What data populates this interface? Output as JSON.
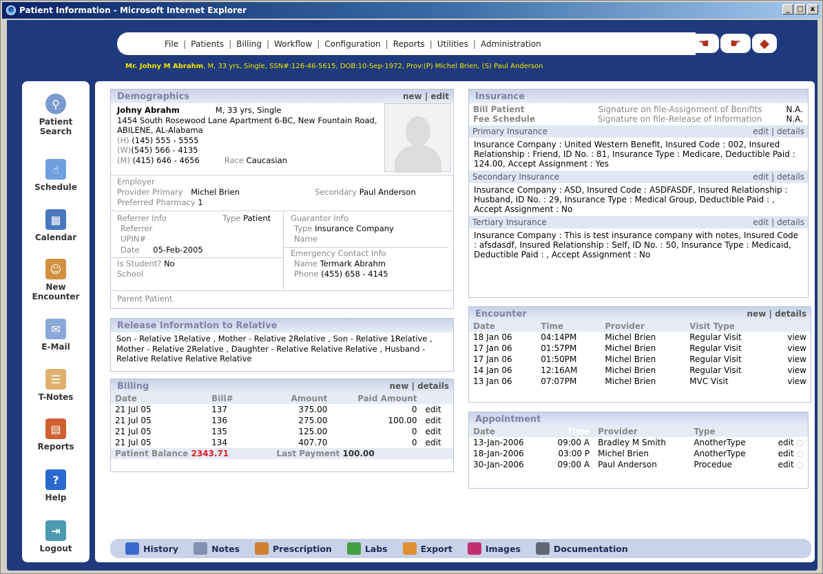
{
  "window": {
    "title": "Patient Information - Microsoft Internet Explorer",
    "min": "_",
    "max": "□",
    "close": "x"
  },
  "menu": [
    "File",
    "Patients",
    "Billing",
    "Workflow",
    "Configuration",
    "Reports",
    "Utilities",
    "Administration"
  ],
  "header_icons": [
    "hand-back-icon",
    "hand-point-icon",
    "book-icon"
  ],
  "patient_bar": {
    "name": "Mr. Johny M Abrahm",
    "details": ", M, 33 yrs, Single, SSN#:126-46-5615, DOB:10-Sep-1972, Prov:(P) Michel Brien, (S) Paul Anderson"
  },
  "nav": [
    {
      "label1": "Patient",
      "label2": "Search",
      "icon": "patient-search-icon"
    },
    {
      "label1": "Schedule",
      "label2": "",
      "icon": "schedule-icon"
    },
    {
      "label1": "Calendar",
      "label2": "",
      "icon": "calendar-icon"
    },
    {
      "label1": "New",
      "label2": "Encounter",
      "icon": "new-encounter-icon"
    },
    {
      "label1": "E-Mail",
      "label2": "",
      "icon": "email-icon"
    },
    {
      "label1": "T-Notes",
      "label2": "",
      "icon": "t-notes-icon"
    },
    {
      "label1": "Reports",
      "label2": "",
      "icon": "reports-icon"
    },
    {
      "label1": "Help",
      "label2": "",
      "icon": "help-icon"
    },
    {
      "label1": "Logout",
      "label2": "",
      "icon": "logout-icon"
    }
  ],
  "demo": {
    "title": "Demographics",
    "new": "new",
    "sep": "|",
    "edit": "edit",
    "name": "Johny Abrahm",
    "summary": "M, 33 yrs, Single",
    "address": "1454 South Rosewood Lane Apartment 6-BC, New Fountain Road, ABILENE, AL-Alabama",
    "h_lbl": "(H)",
    "h": "(145) 555 - 5555",
    "w_lbl": "(W)",
    "w": "(545) 566 - 4135",
    "m_lbl": "(M)",
    "m": "(415) 646 - 4656",
    "race_lbl": "Race",
    "race": "Caucasian",
    "employer_lbl": "Employer",
    "prov_prim_lbl": "Provider Primary",
    "prov_prim": "Michel Brien",
    "secondary_lbl": "Secondary",
    "secondary": "Paul Anderson",
    "pharm_lbl": "Preferred Pharmacy",
    "pharm": "1",
    "ref_info_lbl": "Referrer Info",
    "type_lbl": "Type",
    "ref_type": "Patient",
    "referrer_lbl": "Referrer",
    "upin_lbl": "UPIN#",
    "date_lbl": "Date",
    "ref_date": "05-Feb-2005",
    "student_lbl": "Is Student?",
    "student": "No",
    "school_lbl": "School",
    "guar_lbl": "Guarantor Info",
    "guar_type": "Insurance Company",
    "name_lbl": "Name",
    "emerg_lbl": "Emergency Contact Info",
    "emerg_name": "Termark Abrahm",
    "phone_lbl": "Phone",
    "emerg_phone": "(455) 658 - 4145",
    "parent_lbl": "Parent Patient"
  },
  "release": {
    "title": "Release Information to Relative",
    "text": "Son - Relative 1Relative , Mother - Relative 2Relative , Son - Relative 1Relative , Mother - Relative 2Relative , Daughter - Relative Relative Relative , Husband - Relative Relative Relative Relative"
  },
  "billing": {
    "title": "Billing",
    "new": "new",
    "sep": "|",
    "details": "details",
    "cols": [
      "Date",
      "Bill#",
      "Amount",
      "Paid Amount"
    ],
    "rows": [
      {
        "date": "21 Jul 05",
        "bill": "137",
        "amount": "375.00",
        "paid": "0",
        "act": "edit"
      },
      {
        "date": "21 Jul 05",
        "bill": "136",
        "amount": "275.00",
        "paid": "100.00",
        "act": "edit"
      },
      {
        "date": "21 Jul 05",
        "bill": "135",
        "amount": "125.00",
        "paid": "0",
        "act": "edit"
      },
      {
        "date": "21 Jul 05",
        "bill": "134",
        "amount": "407.70",
        "paid": "0",
        "act": "edit"
      }
    ],
    "balance_lbl": "Patient Balance",
    "balance": "2343.71",
    "last_lbl": "Last Payment",
    "last": "100.00"
  },
  "insurance": {
    "title": "Insurance",
    "bill_lbl": "Bill Patient",
    "fee_lbl": "Fee Schedule",
    "sig1": "Signature on file-Assignment of Benifits",
    "sig1_val": "N.A.",
    "sig2": "Signature on file-Release of Information",
    "sig2_val": "N.A.",
    "edit": "edit",
    "sep": "|",
    "details": "details",
    "primary_lbl": "Primary Insurance",
    "primary": "Insurance Company : United Western Benefit, Insured Code : 002, Insured Relationship : Friend, ID No. : 81, Insurance Type : Medicare, Deductible Paid : 124.00, Accept Assignment : Yes",
    "secondary_lbl": "Secondary Insurance",
    "secondary": "Insurance Company : ASD, Insured Code : ASDFASDF, Insured Relationship : Husband, ID No. : 29, Insurance Type : Medical Group, Deductible Paid : , Accept Assignment : No",
    "tertiary_lbl": "Tertiary Insurance",
    "tertiary": "Insurance Company : This is test insurance company with notes, Insured Code : afsdasdf, Insured Relationship : Self, ID No. : 50, Insurance Type : Medicaid, Deductible Paid : , Accept Assignment : No"
  },
  "encounter": {
    "title": "Encounter",
    "new": "new",
    "sep": "|",
    "details": "details",
    "cols": [
      "Date",
      "Time",
      "Provider",
      "Visit Type"
    ],
    "rows": [
      {
        "date": "18 Jan 06",
        "time": "04:14PM",
        "prov": "Michel Brien",
        "type": "Regular Visit",
        "act": "view"
      },
      {
        "date": "17 Jan 06",
        "time": "01:57PM",
        "prov": "Michel Brien",
        "type": "Regular Visit",
        "act": "view"
      },
      {
        "date": "17 Jan 06",
        "time": "01:50PM",
        "prov": "Michel Brien",
        "type": "Regular Visit",
        "act": "view"
      },
      {
        "date": "14 Jan 06",
        "time": "12:16AM",
        "prov": "Michel Brien",
        "type": "Regular Visit",
        "act": "view"
      },
      {
        "date": "13 Jan 06",
        "time": "07:07PM",
        "prov": "Michel Brien",
        "type": "MVC Visit",
        "act": "view"
      }
    ]
  },
  "appointment": {
    "title": "Appointment",
    "cols": [
      "Date",
      "Time",
      "Provider",
      "Type"
    ],
    "rows": [
      {
        "date": "13-Jan-2006",
        "time": "09:00 A",
        "prov": "Bradley M Smith",
        "type": "AnotherType",
        "act": "edit"
      },
      {
        "date": "18-Jan-2006",
        "time": "03:00 P",
        "prov": "Michel Brien",
        "type": "AnotherType",
        "act": "edit"
      },
      {
        "date": "30-Jan-2006",
        "time": "09:00 A",
        "prov": "Paul Anderson",
        "type": "Procedue",
        "act": "edit"
      }
    ]
  },
  "bottom": [
    {
      "label": "History",
      "icon": "history-icon",
      "color": "#3a6ad0"
    },
    {
      "label": "Notes",
      "icon": "notes-icon",
      "color": "#8090b0"
    },
    {
      "label": "Prescription",
      "icon": "prescription-icon",
      "color": "#d08030"
    },
    {
      "label": "Labs",
      "icon": "labs-icon",
      "color": "#40a040"
    },
    {
      "label": "Export",
      "icon": "export-icon",
      "color": "#e09030"
    },
    {
      "label": "Images",
      "icon": "images-icon",
      "color": "#c03070"
    },
    {
      "label": "Documentation",
      "icon": "documentation-icon",
      "color": "#606878"
    }
  ]
}
